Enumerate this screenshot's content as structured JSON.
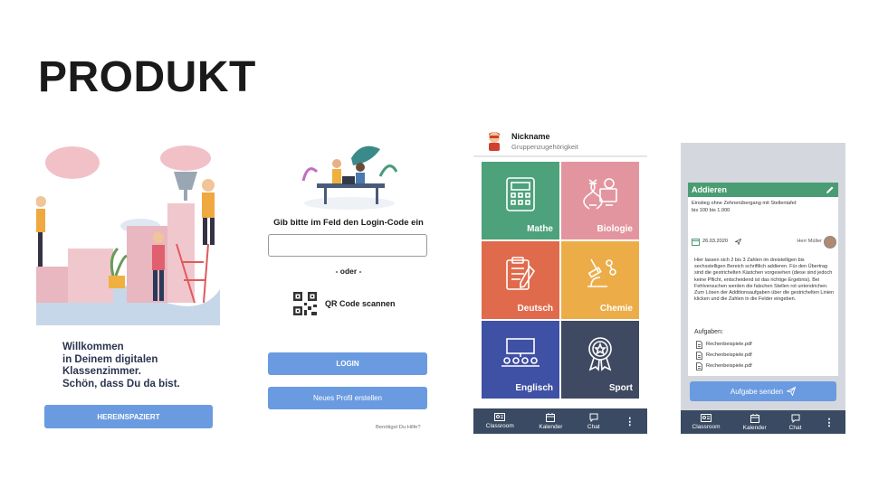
{
  "slide": {
    "title": "PRODUKT"
  },
  "welcome_screen": {
    "lines": [
      "Willkommen",
      "in Deinem digitalen",
      "Klassenzimmer.",
      "Schön, dass Du da bist."
    ],
    "enter_button": "HEREINSPAZIERT"
  },
  "login_screen": {
    "prompt": "Gib bitte im Feld den Login-Code ein",
    "code_input_value": "",
    "or_divider": "- oder -",
    "qr_label": "QR Code scannen",
    "login_button": "LOGIN",
    "new_profile_button": "Neues Profil erstellen",
    "help_link": "Benötigst Du Hilfe?"
  },
  "classroom_screen": {
    "nickname": "Nickname",
    "group": "Gruppenzugehörigkeit",
    "subjects": [
      {
        "label": "Mathe",
        "color": "#4da17b",
        "icon": "calculator-icon"
      },
      {
        "label": "Biologie",
        "color": "#e3959f",
        "icon": "dna-icon"
      },
      {
        "label": "Deutsch",
        "color": "#e06a4c",
        "icon": "clipboard-pen-icon"
      },
      {
        "label": "Chemie",
        "color": "#ecad48",
        "icon": "microscope-icon"
      },
      {
        "label": "Englisch",
        "color": "#3f51a4",
        "icon": "classroom-icon"
      },
      {
        "label": "Sport",
        "color": "#3f4a62",
        "icon": "medal-icon"
      }
    ],
    "nav": [
      "Classroom",
      "Kalender",
      "Chat"
    ]
  },
  "task_screen": {
    "card_title": "Addieren",
    "subtitle_lines": [
      "Einstieg ohne Zehnerübergang mit Stellentafel:",
      "bis 100  bis 1.000"
    ],
    "date": "26.03.2020",
    "teacher": "Herr Müller",
    "description": "Hier lassen sich 2 bis 3 Zahlen im dreistelligen bis sechsstelligen Bereich schriftlich addieren. Für den Übertrag sind die gestrichelten Kästchen vorgesehen (diese sind jedoch keine Pflicht, entscheidend ist das richtige Ergebnis). Bei Fehlversuchen werden die falschen Stellen rot unterstrichen. Zum Lösen der Additionsaufgaben über die gestrichelten Linien klicken und die Zahlen in die Felder eingeben.",
    "tasks_label": "Aufgaben:",
    "files": [
      "Rechenbeispiele.pdf",
      "Rechenbeispiele.pdf",
      "Rechenbeispiele.pdf"
    ],
    "submit_button": "Aufgabe senden",
    "nav": [
      "Classroom",
      "Kalender",
      "Chat"
    ]
  },
  "colors": {
    "accent": "#6a9be0",
    "nav": "#3a4a62",
    "card_header": "#4a9c73"
  }
}
